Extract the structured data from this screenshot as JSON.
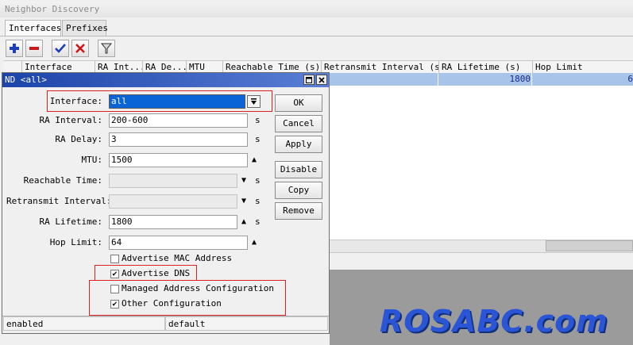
{
  "window": {
    "title": "Neighbor Discovery"
  },
  "tabs": [
    {
      "label": "Interfaces"
    },
    {
      "label": "Prefixes"
    }
  ],
  "toolbar": {
    "icons": [
      "plus-icon",
      "minus-icon",
      "check-icon",
      "cross-icon",
      "filter-icon"
    ]
  },
  "table": {
    "columns": [
      "Interface",
      "RA Int...",
      "RA De...",
      "MTU",
      "Reachable Time (s)",
      "Retransmit Interval (s)",
      "RA Lifetime (s)",
      "Hop Limit"
    ],
    "row": {
      "ra_lifetime": "1800",
      "hop_limit": "6"
    }
  },
  "dialog": {
    "title": "ND <all>",
    "fields": {
      "interface": {
        "label": "Interface:",
        "value": "all"
      },
      "ra_interval": {
        "label": "RA Interval:",
        "value": "200-600",
        "unit": "s"
      },
      "ra_delay": {
        "label": "RA Delay:",
        "value": "3",
        "unit": "s"
      },
      "mtu": {
        "label": "MTU:",
        "value": "1500"
      },
      "reachable_time": {
        "label": "Reachable Time:",
        "value": "",
        "unit": "s"
      },
      "retransmit_interval": {
        "label": "Retransmit Interval:",
        "value": "",
        "unit": "s"
      },
      "ra_lifetime": {
        "label": "RA Lifetime:",
        "value": "1800",
        "unit": "s"
      },
      "hop_limit": {
        "label": "Hop Limit:",
        "value": "64"
      }
    },
    "checkboxes": {
      "advertise_mac": {
        "label": "Advertise MAC Address",
        "checked": false
      },
      "advertise_dns": {
        "label": "Advertise DNS",
        "checked": true
      },
      "managed_address": {
        "label": "Managed Address Configuration",
        "checked": false
      },
      "other_config": {
        "label": "Other Configuration",
        "checked": true
      }
    },
    "buttons": {
      "ok": "OK",
      "cancel": "Cancel",
      "apply": "Apply",
      "disable": "Disable",
      "copy": "Copy",
      "remove": "Remove"
    },
    "status": {
      "left": "enabled",
      "right": "default"
    }
  },
  "watermark": "ROSABC.com",
  "colors": {
    "title_bar": "#1c43a8",
    "highlight": "#e02020",
    "selection": "#a8c4e8",
    "watermark": "#2a55d6"
  }
}
